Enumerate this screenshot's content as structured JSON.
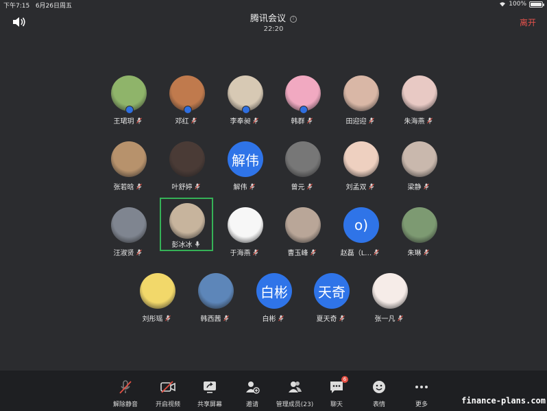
{
  "status_bar": {
    "time": "下午7:15",
    "date": "6月26日周五",
    "battery": "100%"
  },
  "header": {
    "title": "腾讯会议",
    "duration": "22:20",
    "leave": "离开"
  },
  "participants": [
    {
      "name": "王珺玥",
      "avatar": "photo",
      "host": true,
      "color": "#8fb46a"
    },
    {
      "name": "邓红",
      "avatar": "photo",
      "host": true,
      "color": "#c07a4d"
    },
    {
      "name": "李奉昶",
      "avatar": "photo",
      "host": true,
      "color": "#d7c9b4"
    },
    {
      "name": "韩群",
      "avatar": "photo",
      "host": true,
      "color": "#f1a9c1"
    },
    {
      "name": "田迎迎",
      "avatar": "photo",
      "color": "#d9b7a6"
    },
    {
      "name": "朱海燕",
      "avatar": "photo",
      "color": "#e8c9c4"
    },
    {
      "name": "张若晗",
      "avatar": "photo",
      "color": "#b7926c"
    },
    {
      "name": "叶舒婷",
      "avatar": "photo",
      "color": "#4a3b36"
    },
    {
      "name": "解伟",
      "avatar": "text",
      "text": "解伟"
    },
    {
      "name": "曾元",
      "avatar": "photo",
      "color": "#777777"
    },
    {
      "name": "刘孟双",
      "avatar": "photo",
      "color": "#eed0c0"
    },
    {
      "name": "梁静",
      "avatar": "photo",
      "color": "#c9b8ad"
    },
    {
      "name": "汪淑贤",
      "avatar": "photo",
      "color": "#7f8590"
    },
    {
      "name": "彭冰冰",
      "avatar": "photo",
      "active": true,
      "color": "#c7b49d"
    },
    {
      "name": "于海燕",
      "avatar": "photo",
      "color": "#f7f7f7"
    },
    {
      "name": "曹玉峰",
      "avatar": "photo",
      "color": "#b9a698"
    },
    {
      "name": "赵磊（L…",
      "avatar": "text",
      "text": "o)"
    },
    {
      "name": "朱琳",
      "avatar": "photo",
      "color": "#7d9a72"
    },
    {
      "name": "刘彤瑶",
      "avatar": "photo",
      "color": "#f2d86a"
    },
    {
      "name": "韩西茜",
      "avatar": "photo",
      "color": "#5d86b9"
    },
    {
      "name": "白彬",
      "avatar": "text",
      "text": "白彬"
    },
    {
      "name": "夏天奇",
      "avatar": "text",
      "text": "天奇"
    },
    {
      "name": "张一凡",
      "avatar": "photo",
      "color": "#f6ece8"
    }
  ],
  "toolbar": [
    {
      "label": "解除静音",
      "icon": "mic-muted-icon"
    },
    {
      "label": "开启视频",
      "icon": "video-off-icon"
    },
    {
      "label": "共享屏幕",
      "icon": "share-screen-icon"
    },
    {
      "label": "邀请",
      "icon": "invite-icon"
    },
    {
      "label": "管理成员(23)",
      "icon": "members-icon"
    },
    {
      "label": "聊天",
      "icon": "chat-icon",
      "badge": "6"
    },
    {
      "label": "表情",
      "icon": "emoji-icon"
    },
    {
      "label": "更多",
      "icon": "more-icon"
    }
  ],
  "watermark": "finance-plans.com"
}
